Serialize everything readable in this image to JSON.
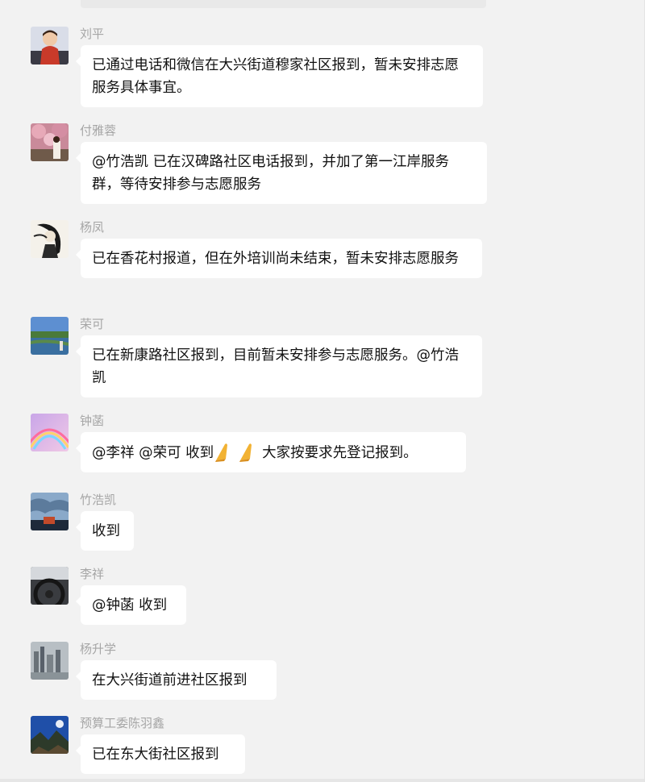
{
  "messages": [
    {
      "sender": "刘平",
      "text": "已通过电话和微信在大兴街道穆家社区报到，暂未安排志愿服务具体事宜。"
    },
    {
      "sender": "付雅蓉",
      "text": "@竹浩凯 已在汉碑路社区电话报到，并加了第一江岸服务群，等待安排参与志愿服务"
    },
    {
      "sender": "杨凤",
      "text": "已在香花村报道，但在外培训尚未结束，暂未安排志愿服务"
    },
    {
      "sender": "荣可",
      "text": "已在新康路社区报到，目前暂未安排参与志愿服务。@竹浩凯"
    },
    {
      "sender": "钟菡",
      "text_part1": "@李祥 @荣可 收到",
      "text_part2": "大家按要求先登记报到。"
    },
    {
      "sender": "竹浩凯",
      "text": "收到"
    },
    {
      "sender": "李祥",
      "text": "@钟菡 收到"
    },
    {
      "sender": "杨升学",
      "text": "在大兴街道前进社区报到"
    },
    {
      "sender": "预算工委陈羽鑫",
      "text": "已在东大街社区报到"
    }
  ]
}
